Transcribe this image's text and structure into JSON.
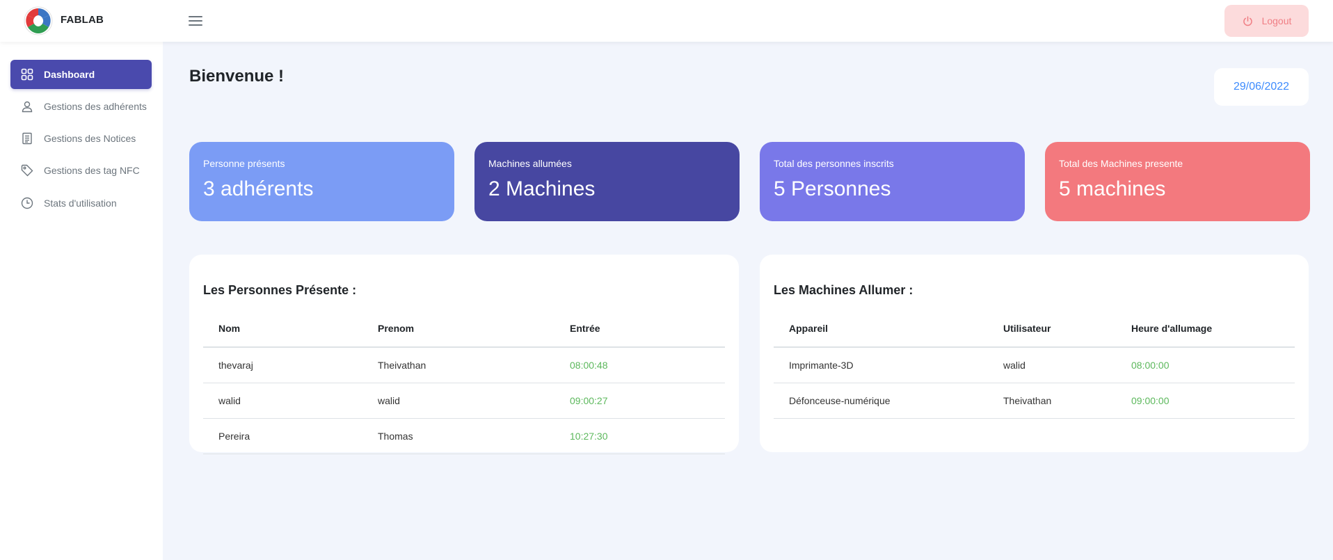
{
  "header": {
    "brand": "FABLAB",
    "logout_label": "Logout"
  },
  "sidebar": {
    "items": [
      {
        "label": "Dashboard",
        "icon": "dashboard-grid-icon",
        "active": true
      },
      {
        "label": "Gestions des adhérents",
        "icon": "user-icon"
      },
      {
        "label": "Gestions des Notices",
        "icon": "document-icon"
      },
      {
        "label": "Gestions des tag NFC",
        "icon": "tag-icon"
      },
      {
        "label": "Stats d'utilisation",
        "icon": "clock-icon"
      }
    ]
  },
  "main": {
    "title": "Bienvenue !",
    "date": "29/06/2022",
    "stats": [
      {
        "label": "Personne présents",
        "value": "3 adhérents",
        "color": "#7b9cf5"
      },
      {
        "label": "Machines allumées",
        "value": "2 Machines",
        "color": "#4747a1"
      },
      {
        "label": "Total des personnes inscrits",
        "value": "5 Personnes",
        "color": "#7978e9"
      },
      {
        "label": "Total des Machines presente",
        "value": "5 machines",
        "color": "#f3797e"
      }
    ],
    "persons_panel": {
      "title": "Les Personnes Présente :",
      "headers": [
        "Nom",
        "Prenom",
        "Entrée"
      ],
      "rows": [
        [
          "thevaraj",
          "Theivathan",
          "08:00:48"
        ],
        [
          "walid",
          "walid",
          "09:00:27"
        ],
        [
          "Pereira",
          "Thomas",
          "10:27:30"
        ]
      ]
    },
    "machines_panel": {
      "title": "Les Machines Allumer :",
      "headers": [
        "Appareil",
        "Utilisateur",
        "Heure d'allumage"
      ],
      "rows": [
        [
          "Imprimante-3D",
          "walid",
          "08:00:00"
        ],
        [
          "Défonceuse-numérique",
          "Theivathan",
          "09:00:00"
        ]
      ]
    }
  }
}
